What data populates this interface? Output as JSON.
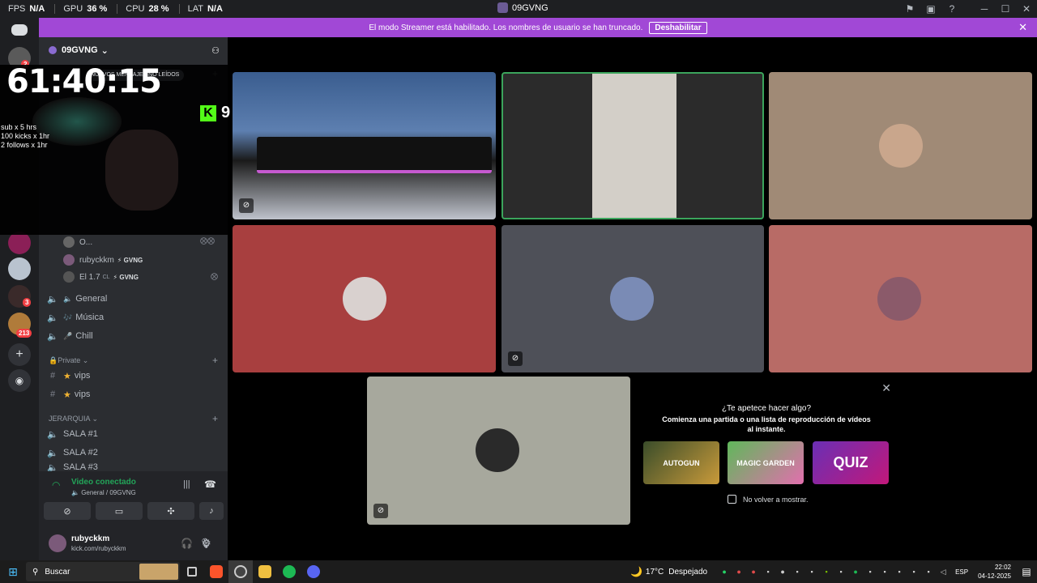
{
  "stats": {
    "fps_label": "FPS",
    "fps_value": "N/A",
    "gpu_label": "GPU",
    "gpu_value": "36 %",
    "cpu_label": "CPU",
    "cpu_value": "28 %",
    "lat_label": "LAT",
    "lat_value": "N/A"
  },
  "window": {
    "title": "09GVNG",
    "minimize": "─",
    "maximize": "☐",
    "close": "✕"
  },
  "banner": {
    "message": "El modo Streamer está habilitado. Los nombres de usuario se han truncado.",
    "disable_label": "Deshabilitar",
    "close": "✕"
  },
  "rail": {
    "badge_top": "2",
    "badge_b": "3",
    "badge_c": "213"
  },
  "server": {
    "name": "09GVNG",
    "chevron": "⌄"
  },
  "overlay": {
    "timer": "61:40:15",
    "goal_1": "sub x 5 hrs",
    "goal_2": "100 kicks x 1hr",
    "goal_3": "2 follows x 1hr",
    "kick_count": "9",
    "unread_label": "NUEVOS MENSAJES NO LEÍDOS"
  },
  "voice_members": [
    {
      "name": "O...",
      "tag": ""
    },
    {
      "name": "rubyckkm",
      "tag": "⚡ GVNG"
    },
    {
      "name": "El 1.7",
      "tag": "⚡ GVNG",
      "suffix": "CL"
    }
  ],
  "voice_channels": [
    {
      "label": "General"
    },
    {
      "label": "Música"
    },
    {
      "label": "Chill"
    }
  ],
  "categories": {
    "private": "Private",
    "jerarquia": "JERARQUIA"
  },
  "private_channels": [
    {
      "label": "vips"
    },
    {
      "label": "vips"
    }
  ],
  "salas": [
    {
      "label": "SALA #1"
    },
    {
      "label": "SALA #2"
    },
    {
      "label": "SALA #3"
    }
  ],
  "voice_panel": {
    "status": "Video conectado",
    "location": "General / 09GVNG"
  },
  "user": {
    "name": "rubyckkm",
    "status": "kick.com/rubyckkm"
  },
  "activity": {
    "question": "¿Te apetece hacer algo?",
    "description": "Comienza una partida o una lista de reproducción de vídeos al instante.",
    "games": [
      "AUTOGUN",
      "MAGIC GARDEN",
      "QUIZ"
    ],
    "dont_show": "No volver a mostrar."
  },
  "taskbar": {
    "search": "Buscar",
    "weather_temp": "17°C",
    "weather_desc": "Despejado",
    "lang": "ESP",
    "time": "22:02",
    "date": "04-12-2025"
  },
  "colors": {
    "banner": "#a148d6",
    "tile_brown": "#a08a76",
    "tile_red": "#a83f3f",
    "tile_slate": "#4e5058",
    "tile_salmon": "#b86b66",
    "tile_grey": "#a7a89d",
    "connected_green": "#23a559"
  }
}
